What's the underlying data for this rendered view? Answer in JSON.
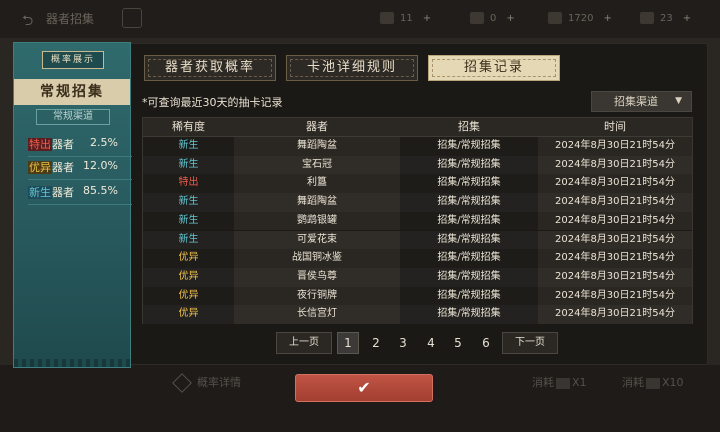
{
  "background": {
    "back_icon": "back-arrow-icon",
    "title": "器者招集",
    "resources": [
      {
        "icon": "paper-icon",
        "value": "11"
      },
      {
        "icon": "vessel-icon",
        "value": "0"
      },
      {
        "icon": "scroll-icon",
        "value": "1720"
      },
      {
        "icon": "card-icon",
        "value": "23"
      }
    ],
    "bottom_left": "概率详情",
    "cost_1": "消耗",
    "cost_1_mult": "X1",
    "cost_2": "消耗",
    "cost_2_mult": "X10"
  },
  "card": {
    "tab": "概率展示",
    "title": "常规招集",
    "subtitle": "常规渠道",
    "rates": [
      {
        "tag": "特出",
        "label": "器者",
        "pct": "2.5%"
      },
      {
        "tag": "优异",
        "label": "器者",
        "pct": "12.0%"
      },
      {
        "tag": "新生",
        "label": "器者",
        "pct": "85.5%"
      }
    ]
  },
  "tabs": [
    "器者获取概率",
    "卡池详细规则",
    "招集记录"
  ],
  "note": "*可查询最近30天的抽卡记录",
  "dropdown": {
    "label": "招集渠道",
    "icon": "caret-down-icon"
  },
  "table": {
    "headers": [
      "稀有度",
      "器者",
      "招集",
      "时间"
    ],
    "rows": [
      {
        "rarity": "新生",
        "item": "舞蹈陶盆",
        "source": "招集/常规招集",
        "time": "2024年8月30日21时54分"
      },
      {
        "rarity": "新生",
        "item": "宝石冠",
        "source": "招集/常规招集",
        "time": "2024年8月30日21时54分"
      },
      {
        "rarity": "特出",
        "item": "利簋",
        "source": "招集/常规招集",
        "time": "2024年8月30日21时54分"
      },
      {
        "rarity": "新生",
        "item": "舞蹈陶盆",
        "source": "招集/常规招集",
        "time": "2024年8月30日21时54分"
      },
      {
        "rarity": "新生",
        "item": "鹦鹉银罐",
        "source": "招集/常规招集",
        "time": "2024年8月30日21时54分"
      },
      {
        "rarity": "新生",
        "item": "可爱花束",
        "source": "招集/常规招集",
        "time": "2024年8月30日21时54分"
      },
      {
        "rarity": "优异",
        "item": "战国铜冰鉴",
        "source": "招集/常规招集",
        "time": "2024年8月30日21时54分"
      },
      {
        "rarity": "优异",
        "item": "晋侯鸟尊",
        "source": "招集/常规招集",
        "time": "2024年8月30日21时54分"
      },
      {
        "rarity": "优异",
        "item": "夜行铜牌",
        "source": "招集/常规招集",
        "time": "2024年8月30日21时54分"
      },
      {
        "rarity": "优异",
        "item": "长信宫灯",
        "source": "招集/常规招集",
        "time": "2024年8月30日21时54分"
      }
    ]
  },
  "rarity_colors": {
    "新生": "#5fc7d2",
    "特出": "#f15c4e",
    "优异": "#f0c24a"
  },
  "pagination": {
    "prev": "上一页",
    "next": "下一页",
    "pages": [
      "1",
      "2",
      "3",
      "4",
      "5",
      "6"
    ],
    "current": "1"
  },
  "confirm": {
    "icon": "checkmark-icon",
    "glyph": "✔"
  }
}
